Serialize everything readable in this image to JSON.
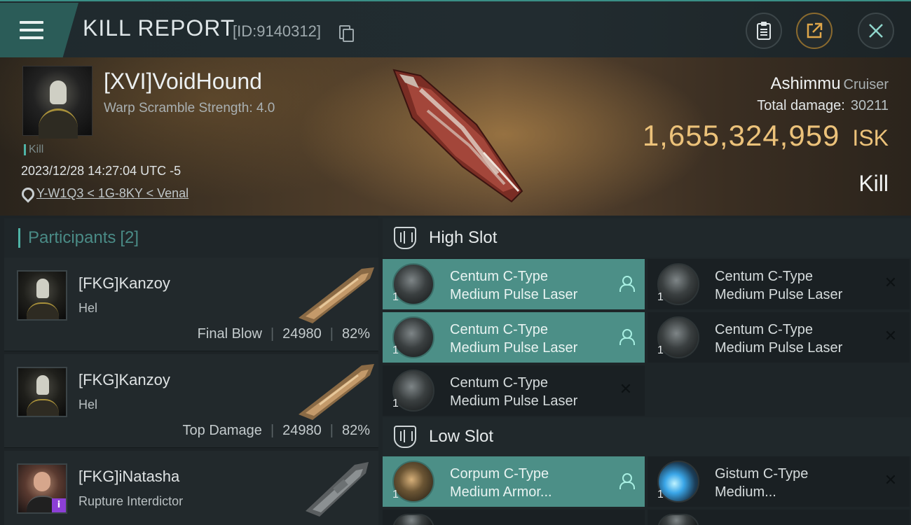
{
  "header": {
    "title": "KILL REPORT",
    "id_text": "[ID:9140312]"
  },
  "victim": {
    "name": "[XVI]VoidHound",
    "subtitle": "Warp Scramble Strength: 4.0",
    "tag": "Kill",
    "datetime": "2023/12/28 14:27:04 UTC -5",
    "location": "Y-W1Q3 < 1G-8KY < Venal",
    "ship_name": "Ashimmu",
    "ship_class": "Cruiser",
    "total_damage_label": "Total damage:",
    "total_damage": "30211",
    "isk_value": "1,655,324,959",
    "isk_unit": "ISK",
    "result": "Kill"
  },
  "participants": {
    "title": "Participants",
    "count": "[2]",
    "rows": [
      {
        "name": "[FKG]Kanzoy",
        "ship": "Hel",
        "label": "Final Blow",
        "damage": "24980",
        "percent": "82%"
      },
      {
        "name": "[FKG]Kanzoy",
        "ship": "Hel",
        "label": "Top Damage",
        "damage": "24980",
        "percent": "82%"
      },
      {
        "name": "[FKG]iNatasha",
        "ship": "Rupture Interdictor",
        "badge": "i"
      }
    ]
  },
  "slots": {
    "high": {
      "title": "High Slot",
      "modules": [
        {
          "line1": "Centum C-Type",
          "line2": "Medium Pulse Laser",
          "qty": "1"
        },
        {
          "line1": "Centum C-Type",
          "line2": "Medium Pulse Laser",
          "qty": "1"
        },
        {
          "line1": "Centum C-Type",
          "line2": "Medium Pulse Laser",
          "qty": "1"
        },
        {
          "line1": "Centum C-Type",
          "line2": "Medium Pulse Laser",
          "qty": "1"
        },
        {
          "line1": "Centum C-Type",
          "line2": "Medium Pulse Laser",
          "qty": "1"
        }
      ]
    },
    "low": {
      "title": "Low Slot",
      "modules": [
        {
          "line1": "Corpum C-Type",
          "line2": "Medium Armor...",
          "qty": "1"
        },
        {
          "line1": "Gistum C-Type",
          "line2": "Medium...",
          "qty": "1"
        }
      ]
    }
  },
  "colors": {
    "accent": "#4fb3a6",
    "fitted": "#4c8f87",
    "isk": "#ecc27a"
  }
}
